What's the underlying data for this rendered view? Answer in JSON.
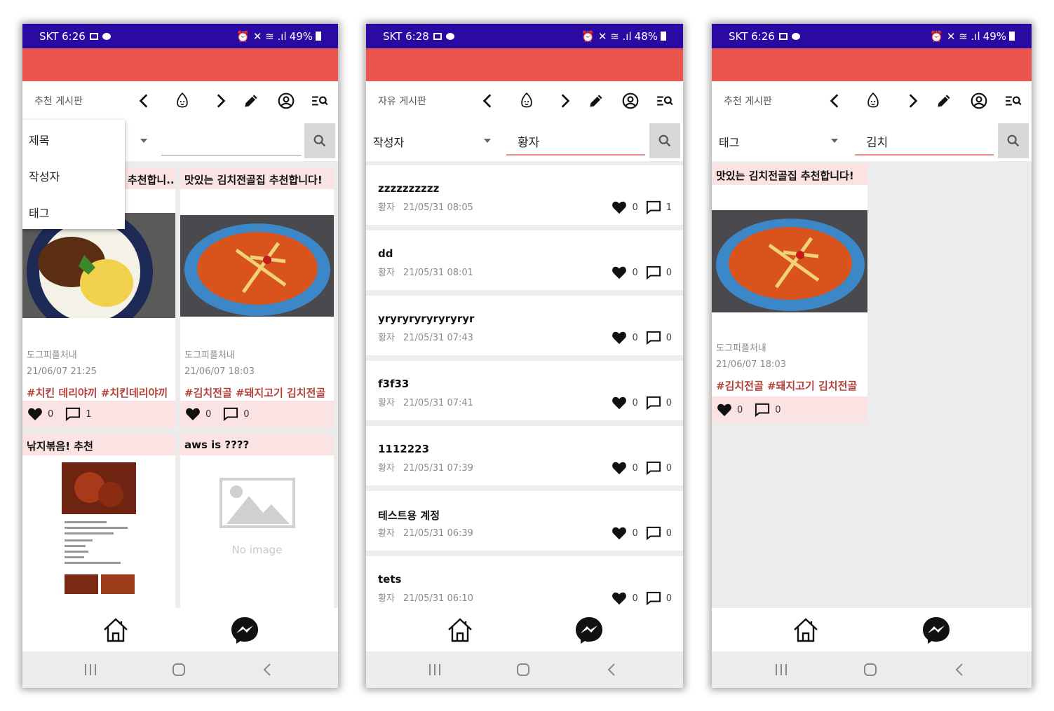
{
  "colors": {
    "status_bar": "#2a0aa3",
    "app_bar": "#ea554e",
    "card_header": "#fbe3e3",
    "tag_text": "#b3403b",
    "content_bg": "#ececec"
  },
  "icons": {
    "toolbar": [
      "chevron-left-icon",
      "mascot-icon",
      "chevron-right-icon",
      "pencil-icon",
      "profile-icon",
      "search-list-icon"
    ],
    "bottom_nav": [
      "home-icon",
      "messenger-icon"
    ],
    "system_nav": [
      "recent-apps-icon",
      "home-circle-icon",
      "back-icon"
    ]
  },
  "screens": [
    {
      "status": {
        "carrier_time": "SKT 6:26",
        "battery": "49%"
      },
      "board_title": "추천 게시판",
      "search": {
        "type": "",
        "query": ""
      },
      "dropdown": [
        "제목",
        "작성자",
        "태그"
      ],
      "cards": [
        {
          "title": "추천합니..",
          "author": "도그피플처내",
          "date": "21/06/07 21:25",
          "tags": "#치킨 데리야끼 #치킨데리야끼",
          "likes": "0",
          "comments": "1"
        },
        {
          "title": "맛있는 김치전골집 추천합니다!",
          "author": "도그피플처내",
          "date": "21/06/07 18:03",
          "tags": "#김치전골 #돼지고기 김치전골",
          "likes": "0",
          "comments": "0"
        },
        {
          "title": "낚지볶음! 추천"
        },
        {
          "title": "aws is ????",
          "no_image_label": "No image"
        }
      ]
    },
    {
      "status": {
        "carrier_time": "SKT 6:28",
        "battery": "48%"
      },
      "board_title": "자유 게시판",
      "search": {
        "type": "작성자",
        "query": "황자"
      },
      "posts": [
        {
          "title": "zzzzzzzzzz",
          "author": "황자",
          "date": "21/05/31 08:05",
          "likes": "0",
          "comments": "1"
        },
        {
          "title": "dd",
          "author": "황자",
          "date": "21/05/31 08:01",
          "likes": "0",
          "comments": "0"
        },
        {
          "title": "yryryryryryryryr",
          "author": "황자",
          "date": "21/05/31 07:43",
          "likes": "0",
          "comments": "0"
        },
        {
          "title": "f3f33",
          "author": "황자",
          "date": "21/05/31 07:41",
          "likes": "0",
          "comments": "0"
        },
        {
          "title": "1112223",
          "author": "황자",
          "date": "21/05/31 07:39",
          "likes": "0",
          "comments": "0"
        },
        {
          "title": "테스트용 계정",
          "author": "황자",
          "date": "21/05/31 06:39",
          "likes": "0",
          "comments": "0"
        },
        {
          "title": "tets",
          "author": "황자",
          "date": "21/05/31 06:10",
          "likes": "0",
          "comments": "0"
        }
      ]
    },
    {
      "status": {
        "carrier_time": "SKT 6:26",
        "battery": "49%"
      },
      "board_title": "추천 게시판",
      "search": {
        "type": "태그",
        "query": "김치"
      },
      "cards": [
        {
          "title": "맛있는 김치전골집 추천합니다!",
          "author": "도그피플처내",
          "date": "21/06/07 18:03",
          "tags": "#김치전골 #돼지고기 김치전골",
          "likes": "0",
          "comments": "0"
        }
      ]
    }
  ]
}
